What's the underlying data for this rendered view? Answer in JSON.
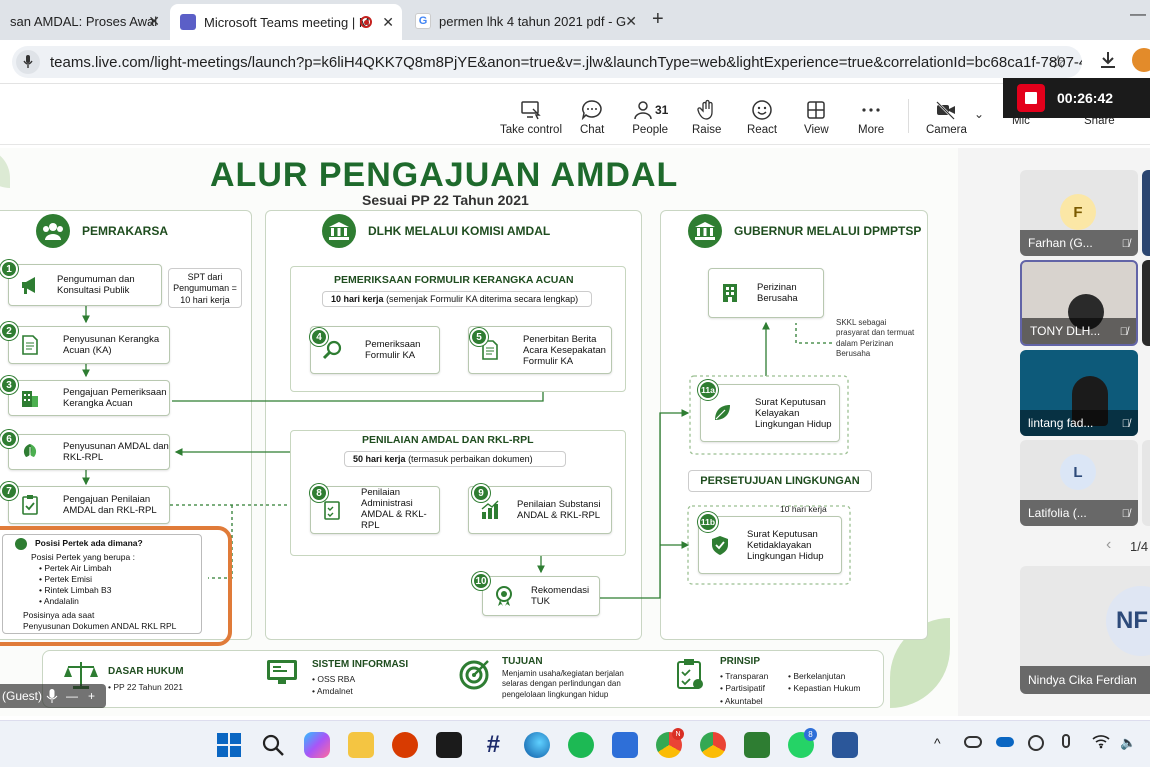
{
  "browser": {
    "tabs": [
      {
        "title": "san AMDAL: Proses Awal"
      },
      {
        "title": "Microsoft Teams meeting | M"
      },
      {
        "title": "permen lhk 4 tahun 2021 pdf - G"
      }
    ],
    "new_tab": "+",
    "url": "teams.live.com/light-meetings/launch?p=k6liH4QKK7Q8m8PjYE&anon=true&v=.jlw&launchType=web&lightExperience=true&correlationId=bc68ca1f-7807-4..."
  },
  "toolbar": {
    "items": [
      {
        "label": "Take control"
      },
      {
        "label": "Chat"
      },
      {
        "label": "People",
        "count": "31"
      },
      {
        "label": "Raise"
      },
      {
        "label": "React"
      },
      {
        "label": "View"
      },
      {
        "label": "More"
      },
      {
        "label": "Camera"
      },
      {
        "label": "Mic"
      },
      {
        "label": "Share"
      }
    ],
    "timer": "00:26:42"
  },
  "slide": {
    "title": "ALUR PENGAJUAN AMDAL",
    "subtitle": "Sesuai PP 22 Tahun 2021",
    "col1": {
      "header": "PEMRAKARSA",
      "steps": [
        {
          "n": "1",
          "text": "Pengumuman dan Konsultasi Publik"
        },
        {
          "n": "2",
          "text": "Penyusunan Kerangka Acuan (KA)"
        },
        {
          "n": "3",
          "text": "Pengajuan Pemeriksaan Kerangka Acuan"
        },
        {
          "n": "6",
          "text": "Penyusunan AMDAL dan RKL-RPL"
        },
        {
          "n": "7",
          "text": "Pengajuan Penilaian AMDAL dan RKL-RPL"
        }
      ],
      "spt_note": "SPT dari Pengumuman = 10 hari kerja",
      "posisi": {
        "title": "Posisi Pertek ada dimana?",
        "intro": "Posisi Pertek yang berupa :",
        "items": [
          "Pertek Air Limbah",
          "Pertek Emisi",
          "Rintek Limbah B3",
          "Andalalin"
        ],
        "outro1": "Posisinya ada saat",
        "outro2": "Penyusunan Dokumen ANDAL RKL RPL"
      }
    },
    "col2": {
      "header": "DLHK MELALUI KOMISI AMDAL",
      "sec1": {
        "title": "PEMERIKSAAN FORMULIR KERANGKA ACUAN",
        "days": "10 hari kerja",
        "days_note": "(semenjak Formulir KA diterima secara lengkap)",
        "steps": [
          {
            "n": "4",
            "text": "Pemeriksaan Formulir KA"
          },
          {
            "n": "5",
            "text": "Penerbitan Berita Acara Kesepakatan Formulir KA"
          }
        ]
      },
      "sec2": {
        "title": "PENILAIAN AMDAL DAN RKL-RPL",
        "days": "50 hari kerja",
        "days_note": "(termasuk perbaikan dokumen)",
        "steps": [
          {
            "n": "8",
            "text": "Penilaian Administrasi AMDAL & RKL-RPL"
          },
          {
            "n": "9",
            "text": "Penilaian Substansi ANDAL & RKL-RPL"
          }
        ]
      },
      "step10": {
        "n": "10",
        "text": "Rekomendasi TUK"
      }
    },
    "col3": {
      "header": "GUBERNUR MELALUI DPMPTSP",
      "perizinan": "Perizinan Berusaha",
      "skkl_note": "SKKL sebagai prasyarat dan termuat dalam Perizinan Berusaha",
      "s11a": {
        "n": "11a",
        "text": "Surat Keputusan Kelayakan Lingkungan Hidup"
      },
      "persetujuan": "PERSETUJUAN LINGKUNGAN",
      "days": "10 hari kerja",
      "s11b": {
        "n": "11b",
        "text": "Surat Keputusan Ketidaklayakan Lingkungan Hidup"
      }
    },
    "footer": {
      "dasar": {
        "title": "DASAR HUKUM",
        "items": [
          "PP 22 Tahun 2021"
        ]
      },
      "sistem": {
        "title": "SISTEM INFORMASI",
        "items": [
          "OSS RBA",
          "Amdalnet"
        ]
      },
      "tujuan": {
        "title": "TUJUAN",
        "text": "Menjamin usaha/kegiatan berjalan selaras dengan perlindungan dan pengelolaan lingkungan hidup"
      },
      "prinsip": {
        "title": "PRINSIP",
        "items": [
          "Transparan",
          "Partisipatif",
          "Akuntabel",
          "Berkelanjutan",
          "Kepastian Hukum"
        ]
      }
    },
    "guest_label": "(Guest)"
  },
  "participants": {
    "tiles": [
      {
        "name": "Farhan (G...",
        "initial": "F"
      },
      {
        "name": "TONY DLH..."
      },
      {
        "name": "lintang fad..."
      },
      {
        "name": "Latifolia (...",
        "initial": "L"
      }
    ],
    "page": "1/4",
    "big": {
      "name": "Nindya Cika Ferdian",
      "initial": "NF"
    }
  }
}
